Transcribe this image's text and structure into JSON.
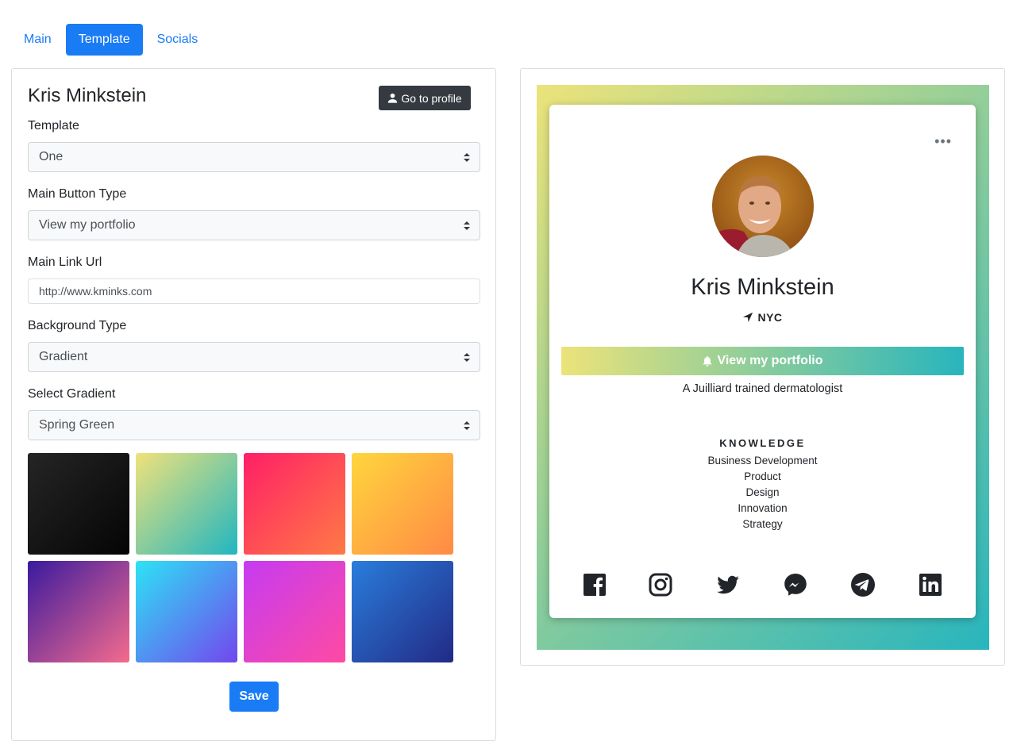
{
  "tabs": [
    {
      "label": "Main"
    },
    {
      "label": "Template"
    },
    {
      "label": "Socials"
    }
  ],
  "editor": {
    "title": "Kris Minkstein",
    "goto_profile_label": "Go to profile",
    "template": {
      "label": "Template",
      "value": "One"
    },
    "main_button_type": {
      "label": "Main Button Type",
      "value": "View my portfolio"
    },
    "main_link_url": {
      "label": "Main Link Url",
      "value": "http://www.kminks.com"
    },
    "background_type": {
      "label": "Background Type",
      "value": "Gradient"
    },
    "select_gradient": {
      "label": "Select Gradient",
      "value": "Spring Green"
    },
    "save_label": "Save"
  },
  "gradients": [
    {
      "from": "#252525",
      "to": "#050505"
    },
    {
      "from": "#f0e27a",
      "to": "#21b6c0"
    },
    {
      "from": "#ff1f66",
      "to": "#ff7a45"
    },
    {
      "from": "#ffd63d",
      "to": "#ff8a45"
    },
    {
      "from": "#3a1a9e",
      "to": "#f46b8e"
    },
    {
      "from": "#2de3f5",
      "to": "#7346ee"
    },
    {
      "from": "#c53bf2",
      "to": "#ff4aa3"
    },
    {
      "from": "#2a7ddc",
      "to": "#222a85"
    }
  ],
  "preview": {
    "background": {
      "from": "#ece37a",
      "to": "#28b5bd"
    },
    "name": "Kris Minkstein",
    "location": "NYC",
    "button_label": "View my portfolio",
    "bio": "A Juilliard trained dermatologist",
    "knowledge_title": "KNOWLEDGE",
    "knowledge": [
      "Business Development",
      "Product",
      "Design",
      "Innovation",
      "Strategy"
    ],
    "socials": [
      "facebook-icon",
      "instagram-icon",
      "twitter-icon",
      "messenger-icon",
      "telegram-icon",
      "linkedin-icon"
    ]
  },
  "colors": {
    "accent": "#1a7cf5",
    "dark_button": "#343a40"
  }
}
